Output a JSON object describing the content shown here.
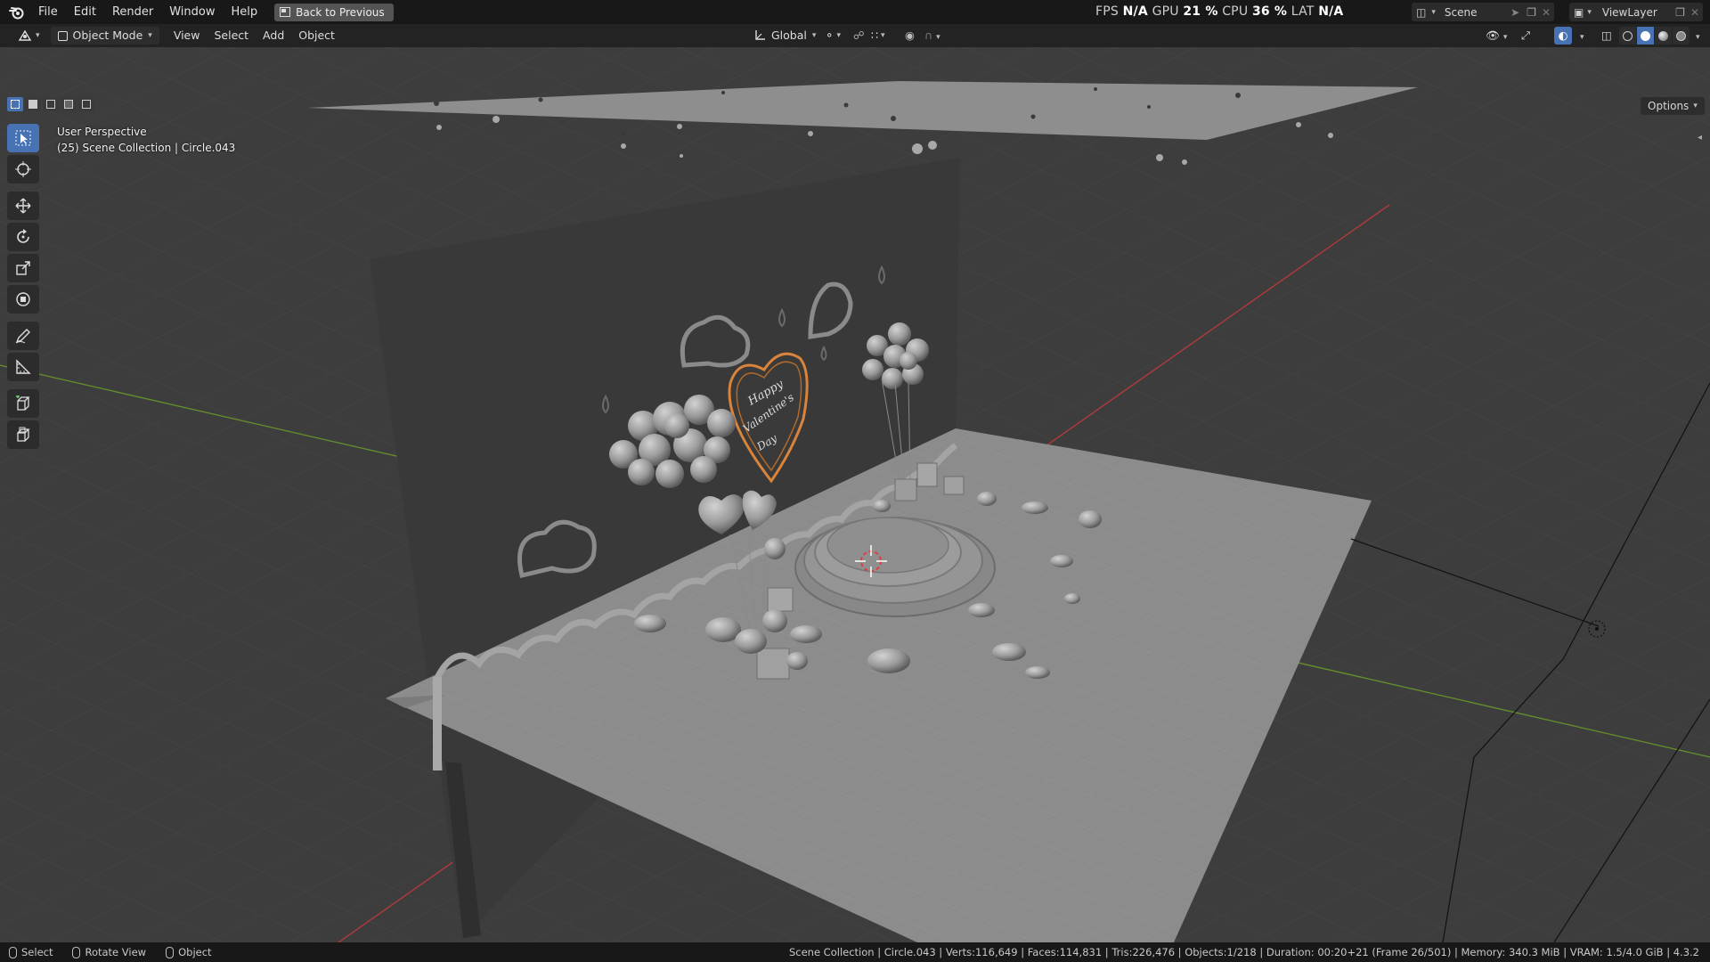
{
  "topbar": {
    "menu": [
      "File",
      "Edit",
      "Render",
      "Window",
      "Help"
    ],
    "back_label": "Back to Previous",
    "stats": {
      "fps_label": "FPS",
      "fps": "N/A",
      "gpu_label": "GPU",
      "gpu": "21 %",
      "cpu_label": "CPU",
      "cpu": "36 %",
      "lat_label": "LAT",
      "lat": "N/A"
    },
    "scene": "Scene",
    "view_layer": "ViewLayer"
  },
  "header": {
    "mode": "Object Mode",
    "menus": [
      "View",
      "Select",
      "Add",
      "Object"
    ],
    "transform_orientation": "Global",
    "options": "Options"
  },
  "viewport": {
    "perspective": "User Perspective",
    "collection_info": "(25) Scene Collection | Circle.043",
    "heart_text_line1": "Happy",
    "heart_text_line2": "Valentine's",
    "heart_text_line3": "Day"
  },
  "statusbar": {
    "select": "Select",
    "rotate": "Rotate View",
    "object": "Object",
    "info": "Scene Collection | Circle.043 | Verts:116,649 | Faces:114,831 | Tris:226,476 | Objects:1/218 | Duration: 00:20+21 (Frame 26/501) | Memory: 340.3 MiB | VRAM: 1.5/4.0 GiB | 4.3.2"
  },
  "colors": {
    "accent": "#4772b3",
    "x_axis": "#c63a3a",
    "y_axis": "#6a9a2a",
    "heart": "#d9843a"
  }
}
